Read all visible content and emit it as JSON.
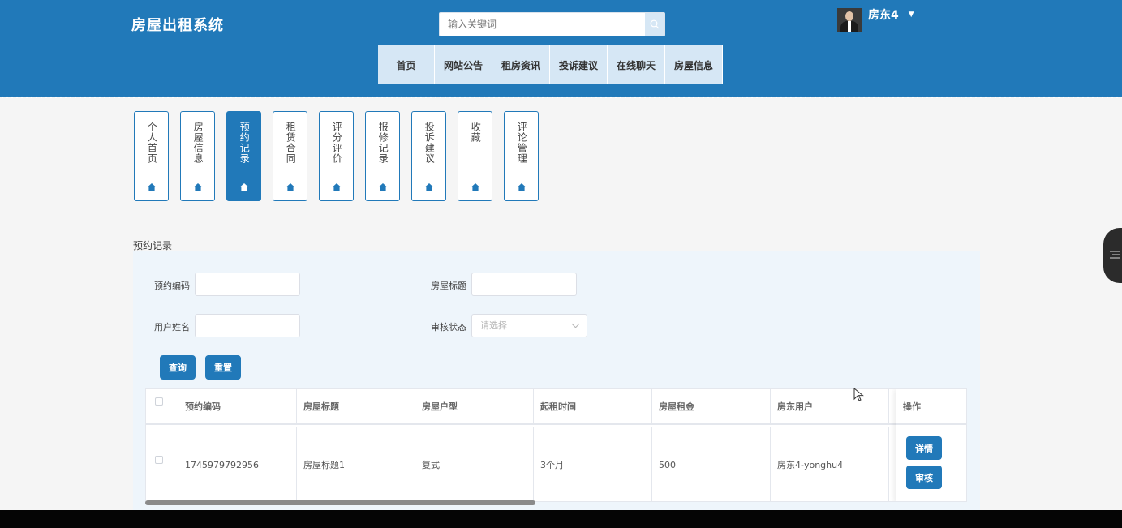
{
  "header": {
    "brand": "房屋出租系统",
    "search_placeholder": "输入关键词",
    "username": "房东4",
    "accent_color": "#2179b9"
  },
  "nav": {
    "items": [
      "首页",
      "网站公告",
      "租房资讯",
      "投诉建议",
      "在线聊天",
      "房屋信息"
    ]
  },
  "vtabs": {
    "items": [
      "个人首页",
      "房屋信息",
      "预约记录",
      "租赁合同",
      "评分评价",
      "报修记录",
      "投诉建议",
      "收藏",
      "评论管理"
    ],
    "active_index": 2,
    "icon": "home-icon"
  },
  "section": {
    "title": "预约记录"
  },
  "filters": {
    "booking_code_label": "预约编码",
    "house_title_label": "房屋标题",
    "user_name_label": "用户姓名",
    "review_status_label": "审核状态",
    "review_status_placeholder": "请选择",
    "query_button": "查询",
    "reset_button": "重置"
  },
  "table": {
    "headers": [
      "预约编码",
      "房屋标题",
      "房屋户型",
      "起租时间",
      "房屋租金",
      "房东用户",
      "操作"
    ],
    "rows": [
      {
        "booking_code": "1745979792956",
        "house_title": "房屋标题1",
        "house_type": "复式",
        "lease_start": "3个月",
        "rent": "500",
        "landlord": "房东4-yonghu4"
      }
    ],
    "detail_button": "详情",
    "review_button": "审核"
  }
}
